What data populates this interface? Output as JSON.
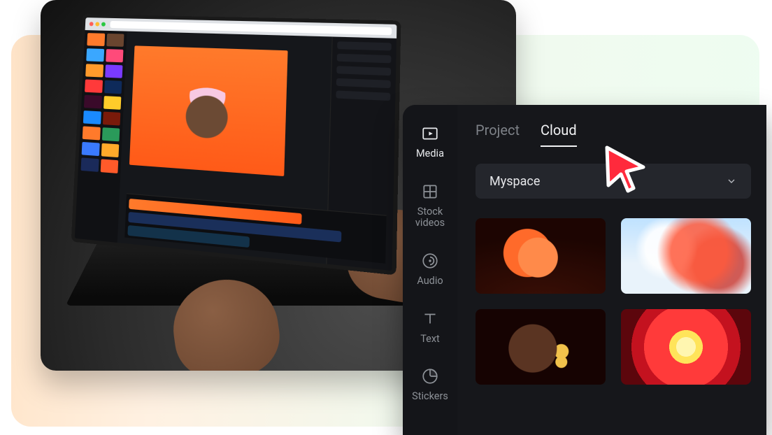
{
  "rail": {
    "items": [
      {
        "key": "media",
        "label": "Media",
        "active": true
      },
      {
        "key": "stock",
        "label": "Stock\nvideos",
        "active": false
      },
      {
        "key": "audio",
        "label": "Audio",
        "active": false
      },
      {
        "key": "text",
        "label": "Text",
        "active": false
      },
      {
        "key": "stickers",
        "label": "Stickers",
        "active": false
      }
    ]
  },
  "tabs": {
    "project": "Project",
    "cloud": "Cloud",
    "active": "cloud"
  },
  "space_select": {
    "selected_label": "Myspace"
  },
  "cloud_grid": {
    "items": [
      {
        "name": "rose",
        "alt": "Orange rose on dark red background"
      },
      {
        "name": "smoke",
        "alt": "Red ink smoke on sky blue"
      },
      {
        "name": "woman",
        "alt": "Woman with gold earrings, red light"
      },
      {
        "name": "dahlia",
        "alt": "Red and yellow dahlia flower macro"
      }
    ]
  },
  "colors": {
    "panel_bg": "#16171b",
    "rail_bg": "#141519",
    "select_bg": "#24262c",
    "text_muted": "#8d9197",
    "text": "#f1f2f4",
    "cursor": "#ff2a3c"
  },
  "laptop_editor": {
    "canvas_subject": "Person with pink hair on orange background",
    "left_thumb_rows": 9,
    "right_controls": 5,
    "timeline_tracks": 3
  }
}
